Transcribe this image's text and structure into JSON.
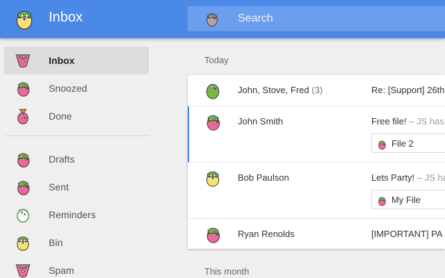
{
  "header": {
    "title": "Inbox",
    "logo_icon": "parrot-icon"
  },
  "search": {
    "placeholder": "Search",
    "value": ""
  },
  "sidebar": {
    "items": [
      {
        "label": "Inbox",
        "icon": "parrot-icon",
        "active": true
      },
      {
        "label": "Snoozed",
        "icon": "parrot-icon"
      },
      {
        "label": "Done",
        "icon": "parrot-icon"
      },
      {
        "label": "Drafts",
        "icon": "parrot-icon"
      },
      {
        "label": "Sent",
        "icon": "parrot-icon"
      },
      {
        "label": "Reminders",
        "icon": "parrot-icon"
      },
      {
        "label": "Bin",
        "icon": "parrot-icon"
      },
      {
        "label": "Spam",
        "icon": "parrot-icon"
      }
    ]
  },
  "sections": {
    "today": "Today",
    "this_month": "This month"
  },
  "messages": [
    {
      "sender": "John, Stove, Fred",
      "count": "(3)",
      "subject": "Re: [Support] 26th",
      "snippet": ""
    },
    {
      "sender": "John Smith",
      "count": "",
      "subject": "Free file!",
      "snippet": " – JS has",
      "attachment": "File 2",
      "selected": true
    },
    {
      "sender": "Bob Paulson",
      "count": "",
      "subject": "Lets Party!",
      "snippet": " – JS has",
      "attachment": "My File"
    },
    {
      "sender": "Ryan Renolds",
      "count": "",
      "subject": "[IMPORTANT] PA",
      "snippet": ""
    }
  ],
  "colors": {
    "accent": "#4a89e6",
    "selected_bar": "#4285f4",
    "pink": "#e8699a",
    "green": "#7ab648",
    "yellow": "#f3e17a"
  }
}
